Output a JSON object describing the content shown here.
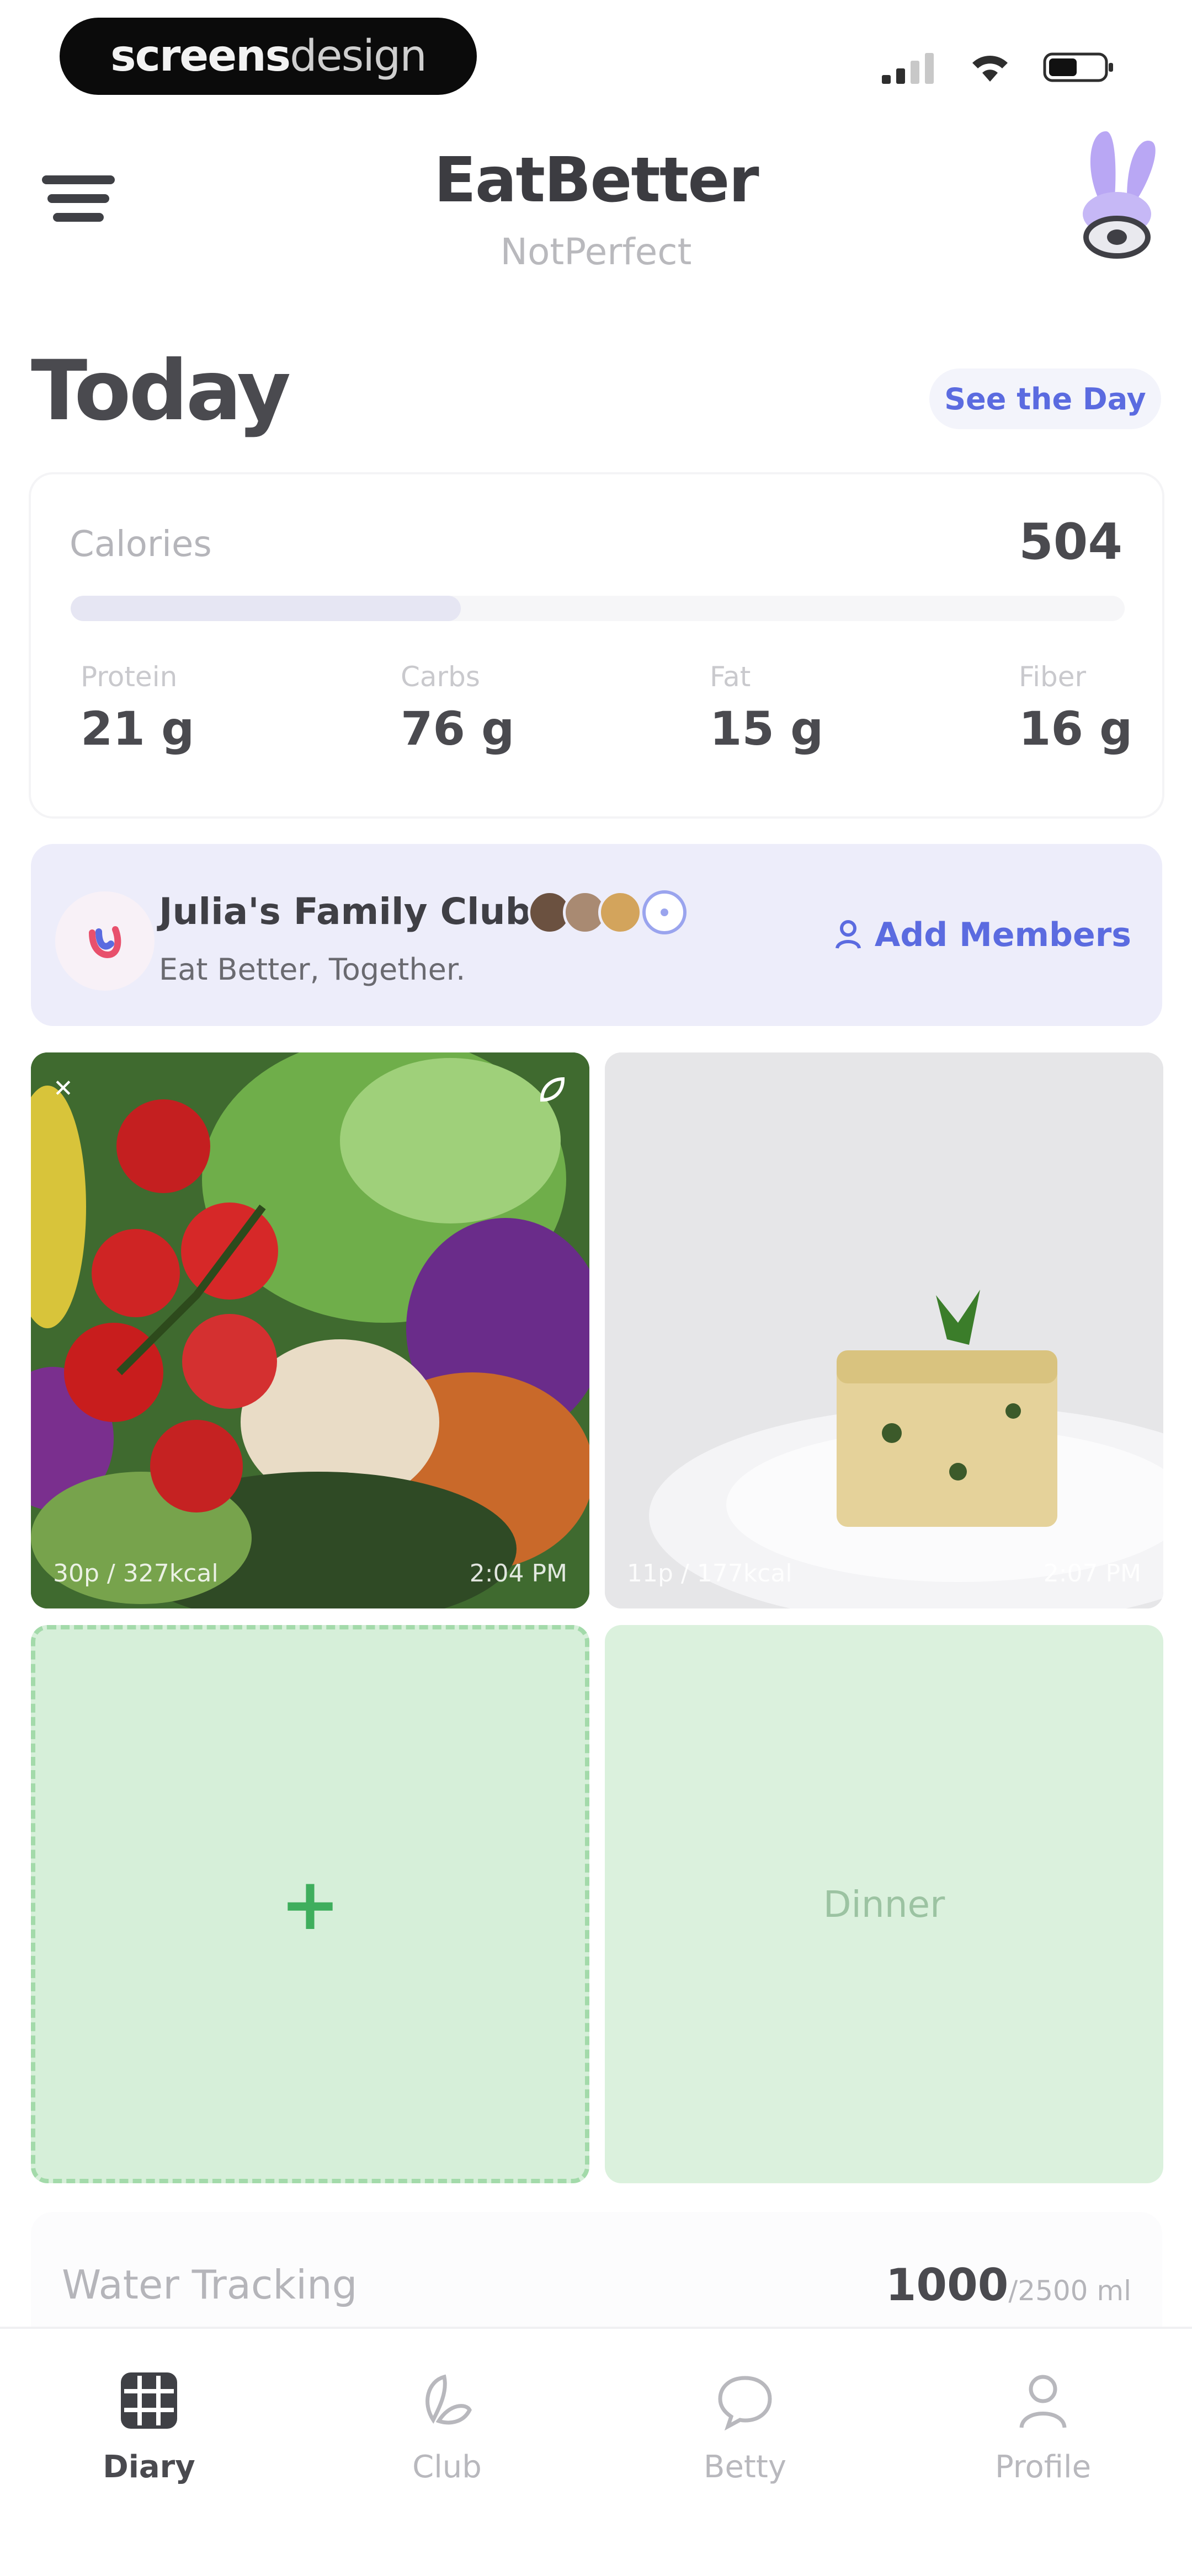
{
  "status_bar": {
    "badge_bold": "screens",
    "badge_light": "design",
    "icons": [
      "cellular-icon",
      "wifi-icon",
      "battery-icon"
    ]
  },
  "header": {
    "title": "EatBetter",
    "subtitle": "NotPerfect"
  },
  "today": {
    "title": "Today",
    "see_day_label": "See the Day"
  },
  "calories": {
    "label": "Calories",
    "value": "504",
    "progress_fraction": 0.37,
    "macros": [
      {
        "label": "Protein",
        "value": "21 g"
      },
      {
        "label": "Carbs",
        "value": "76 g"
      },
      {
        "label": "Fat",
        "value": "15 g"
      },
      {
        "label": "Fiber",
        "value": "16 g"
      }
    ]
  },
  "club": {
    "name": "Julia's Family Club",
    "tagline": "Eat Better, Together.",
    "add_members_label": "Add Members"
  },
  "meals": [
    {
      "caption_left": "30p / 327kcal",
      "caption_right": "2:04 PM"
    },
    {
      "caption_left": "11p / 177kcal",
      "caption_right": "2:07 PM"
    }
  ],
  "dinner_label": "Dinner",
  "add_symbol": "+",
  "water": {
    "label": "Water Tracking",
    "value": "1000",
    "goal": "/2500 ml"
  },
  "tabs": [
    {
      "label": "Diary",
      "icon": "grid-icon",
      "active": true
    },
    {
      "label": "Club",
      "icon": "leaf-icon",
      "active": false
    },
    {
      "label": "Betty",
      "icon": "chat-bubble-icon",
      "active": false
    },
    {
      "label": "Profile",
      "icon": "person-icon",
      "active": false
    }
  ],
  "colors": {
    "accent": "#5b6be0",
    "club_bg": "#ededfa",
    "add_tile_bg": "#d6efd9",
    "add_green": "#3fae5d"
  }
}
